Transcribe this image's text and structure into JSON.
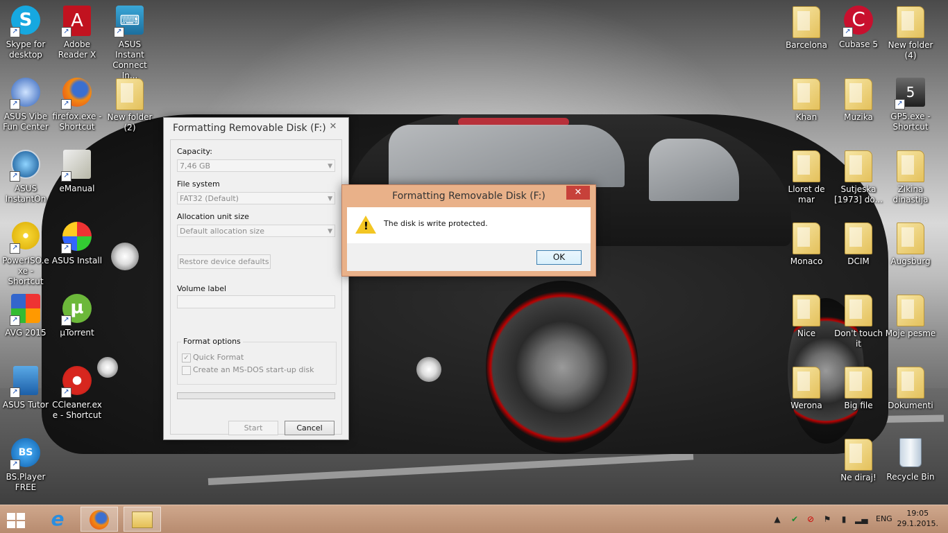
{
  "desktop": {
    "icons": [
      {
        "label": "Skype for desktop"
      },
      {
        "label": "Adobe Reader X"
      },
      {
        "label": "ASUS Instant Connect In..."
      },
      {
        "label": "ASUS  Vibe Fun Center"
      },
      {
        "label": "firefox.exe - Shortcut"
      },
      {
        "label": "New folder (2)"
      },
      {
        "label": "ASUS InstantOn"
      },
      {
        "label": "eManual"
      },
      {
        "label": "PowerISO.exe - Shortcut"
      },
      {
        "label": "ASUS Install"
      },
      {
        "label": "AVG 2015"
      },
      {
        "label": "µTorrent"
      },
      {
        "label": "ASUS Tutor"
      },
      {
        "label": "CCleaner.exe - Shortcut"
      },
      {
        "label": "BS.Player FREE"
      },
      {
        "label": "Barcelona"
      },
      {
        "label": "Cubase 5"
      },
      {
        "label": "New folder (4)"
      },
      {
        "label": "Khan"
      },
      {
        "label": "Muzika"
      },
      {
        "label": "GP5.exe - Shortcut"
      },
      {
        "label": "Lloret de mar"
      },
      {
        "label": "Sutjeska [1973] do..."
      },
      {
        "label": "Zikina dinastija"
      },
      {
        "label": "Monaco"
      },
      {
        "label": "DCIM"
      },
      {
        "label": "Augsburg"
      },
      {
        "label": "Nice"
      },
      {
        "label": "Don't touch it"
      },
      {
        "label": "Moje pesme"
      },
      {
        "label": "Werona"
      },
      {
        "label": "Big file"
      },
      {
        "label": "Dokumenti"
      },
      {
        "label": "Ne diraj!"
      },
      {
        "label": "Recycle Bin"
      }
    ]
  },
  "format_dialog": {
    "title": "Formatting Removable Disk (F:)",
    "close": "✕",
    "capacity_label": "Capacity:",
    "capacity_value": "7,46 GB",
    "filesystem_label": "File system",
    "filesystem_value": "FAT32 (Default)",
    "allocation_label": "Allocation unit size",
    "allocation_value": "Default allocation size",
    "restore_button": "Restore device defaults",
    "volume_label": "Volume label",
    "volume_value": "",
    "format_options_label": "Format options",
    "quick_format_label": "Quick Format",
    "quick_format_checked": true,
    "msdos_label": "Create an MS-DOS start-up disk",
    "msdos_checked": false,
    "progress": 0,
    "start_button": "Start",
    "cancel_button": "Cancel"
  },
  "message_box": {
    "title": "Formatting Removable Disk (F:)",
    "close": "✕",
    "icon": "warning-icon",
    "message": "The disk is write protected.",
    "ok_button": "OK"
  },
  "taskbar": {
    "pinned": [
      "windows-start-icon",
      "internet-explorer-icon",
      "firefox-icon",
      "file-explorer-icon"
    ],
    "language": "ENG",
    "time": "19:05",
    "date": "29.1.2015."
  },
  "colors": {
    "taskbar": "#b78b6f",
    "msgbox_frame": "#e9b189",
    "close_red": "#c7413a"
  }
}
